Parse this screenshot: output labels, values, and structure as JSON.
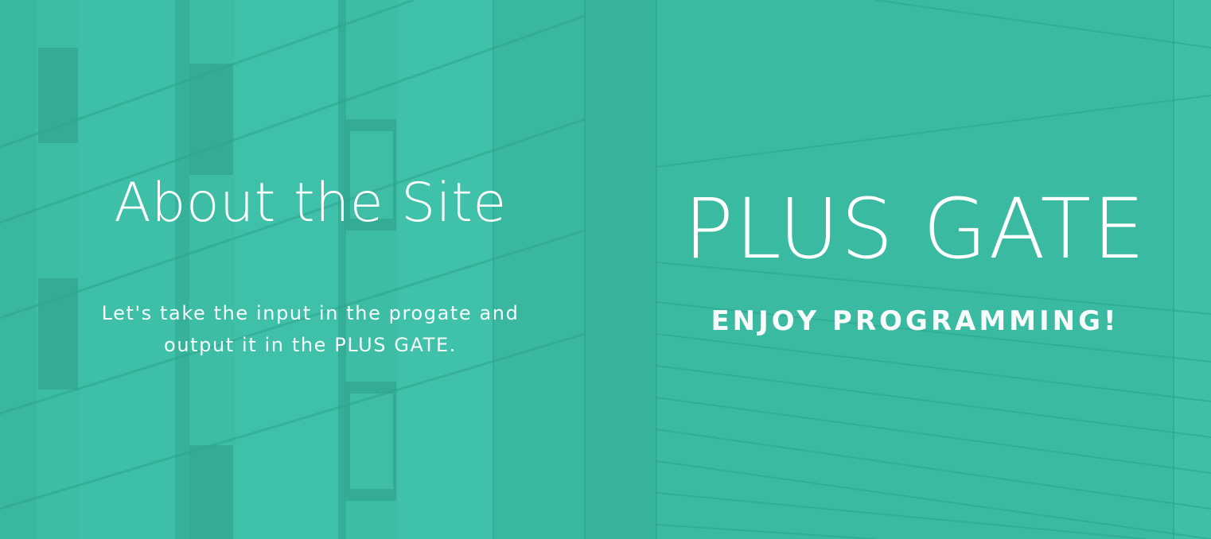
{
  "about": {
    "title": "About the Site",
    "description": "Let's take the input in the progate and output it in the PLUS GATE."
  },
  "brand": {
    "title": "PLUS GATE",
    "tagline": "ENJOY PROGRAMMING!"
  },
  "colors": {
    "overlay": "#3dbfa5",
    "text": "#ffffff"
  }
}
